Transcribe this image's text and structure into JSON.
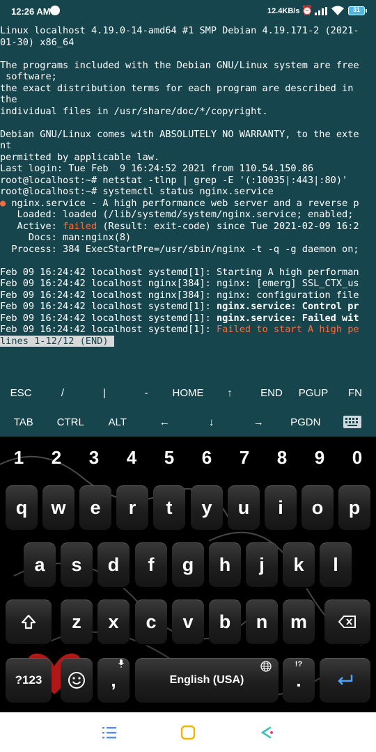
{
  "status_bar": {
    "time": "12:26 AM",
    "speed": "12.4KB/s",
    "battery": "31",
    "icons": [
      "notification-icon",
      "alarm-icon",
      "signal-icon",
      "wifi-icon",
      "battery-icon"
    ]
  },
  "terminal": {
    "lines": [
      [
        {
          "t": "Linux localhost 4.19.0-14-amd64 #1 SMP Debian 4.19.171-2 (2021-"
        }
      ],
      [
        {
          "t": "01-30) x86_64"
        }
      ],
      [
        {
          "t": ""
        }
      ],
      [
        {
          "t": "The programs included with the Debian GNU/Linux system are free"
        }
      ],
      [
        {
          "t": " software;"
        }
      ],
      [
        {
          "t": "the exact distribution terms for each program are described in"
        }
      ],
      [
        {
          "t": "the"
        }
      ],
      [
        {
          "t": "individual files in /usr/share/doc/*/copyright."
        }
      ],
      [
        {
          "t": ""
        }
      ],
      [
        {
          "t": "Debian GNU/Linux comes with ABSOLUTELY NO WARRANTY, to the exte"
        }
      ],
      [
        {
          "t": "nt"
        }
      ],
      [
        {
          "t": "permitted by applicable law."
        }
      ],
      [
        {
          "t": "Last login: Tue Feb  9 16:24:52 2021 from 110.54.150.86"
        }
      ],
      [
        {
          "t": "root@localhost:~# netstat -tlnp | grep -E '(:10035|:443|:80)'"
        }
      ],
      [
        {
          "t": "root@localhost:~# systemctl status nginx.service"
        }
      ],
      [
        {
          "t": "●",
          "c": "dot"
        },
        {
          "t": " nginx.service - A high performance web server and a reverse p"
        }
      ],
      [
        {
          "t": "   Loaded: loaded (/lib/systemd/system/nginx.service; enabled;"
        }
      ],
      [
        {
          "t": "   Active: "
        },
        {
          "t": "failed",
          "c": "red"
        },
        {
          "t": " (Result: exit-code) since Tue 2021-02-09 16:2"
        }
      ],
      [
        {
          "t": "     Docs: man:nginx(8)"
        }
      ],
      [
        {
          "t": "  Process: 384 ExecStartPre=/usr/sbin/nginx -t -q -g daemon on;"
        }
      ],
      [
        {
          "t": ""
        }
      ],
      [
        {
          "t": "Feb 09 16:24:42 localhost systemd[1]: Starting A high performan"
        }
      ],
      [
        {
          "t": "Feb 09 16:24:42 localhost nginx[384]: nginx: [emerg] SSL_CTX_us"
        }
      ],
      [
        {
          "t": "Feb 09 16:24:42 localhost nginx[384]: nginx: configuration file"
        }
      ],
      [
        {
          "t": "Feb 09 16:24:42 localhost systemd[1]: "
        },
        {
          "t": "nginx.service: Control pr",
          "c": "bold"
        }
      ],
      [
        {
          "t": "Feb 09 16:24:42 localhost systemd[1]: "
        },
        {
          "t": "nginx.service: Failed wit",
          "c": "bold"
        }
      ],
      [
        {
          "t": "Feb 09 16:24:42 localhost systemd[1]: "
        },
        {
          "t": "Failed to start A high pe",
          "c": "red"
        }
      ],
      [
        {
          "t": "lines 1-12/12 (END)",
          "c": "pager"
        },
        {
          "t": " ",
          "c": "cursor"
        }
      ]
    ]
  },
  "extra_keys": {
    "row1": [
      "ESC",
      "/",
      "|",
      "-",
      "HOME",
      "↑",
      "END",
      "PGUP",
      "FN"
    ],
    "row2": [
      "TAB",
      "CTRL",
      "ALT",
      "←",
      "↓",
      "→",
      "PGDN"
    ],
    "keyboard_icon": "keyboard-icon"
  },
  "keyboard": {
    "numbers": [
      "1",
      "2",
      "3",
      "4",
      "5",
      "6",
      "7",
      "8",
      "9",
      "0"
    ],
    "row1": [
      "q",
      "w",
      "e",
      "r",
      "t",
      "y",
      "u",
      "i",
      "o",
      "p"
    ],
    "row2": [
      "a",
      "s",
      "d",
      "f",
      "g",
      "h",
      "j",
      "k",
      "l"
    ],
    "row3": [
      "z",
      "x",
      "c",
      "v",
      "b",
      "n",
      "m"
    ],
    "symbols_label": "?123",
    "comma_label": ",",
    "space_label": "English (USA)",
    "period_label": ".",
    "period_hint": "!?",
    "shift_icon": "shift-icon",
    "backspace_icon": "backspace-icon",
    "emoji_icon": "emoji-icon",
    "mic_icon": "mic-icon",
    "globe_icon": "globe-icon",
    "enter_icon": "enter-icon"
  },
  "nav_bar": {
    "icons": [
      "menu-icon",
      "home-icon",
      "back-icon"
    ],
    "colors": {
      "menu": "#5a8ee8",
      "home": "#f5b400",
      "back": "#3ec1b8"
    }
  }
}
